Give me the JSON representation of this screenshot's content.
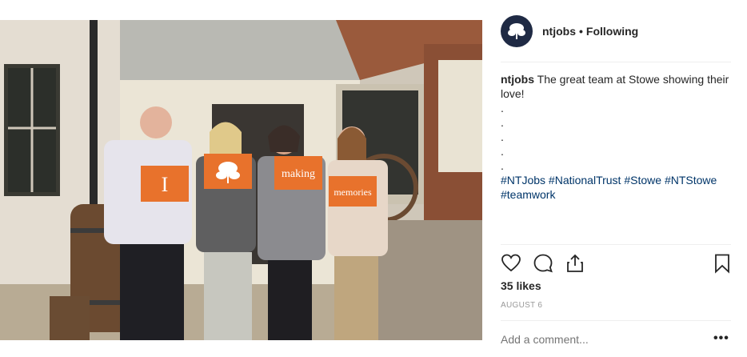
{
  "post": {
    "username": "ntjobs",
    "separator": "•",
    "follow_status": "Following",
    "caption_user": "ntjobs",
    "caption_text": "The great team at Stowe showing their love!",
    "caption_dots": [
      ".",
      ".",
      ".",
      ".",
      "."
    ],
    "hashtags": [
      "#NTJobs",
      "#NationalTrust",
      "#Stowe",
      "#NTStowe",
      "#teamwork"
    ],
    "likes": "35 likes",
    "date": "AUGUST 6",
    "comment_placeholder": "Add a comment...",
    "more_label": "•••"
  },
  "photo": {
    "signs": [
      "I",
      "making",
      "memories"
    ]
  },
  "colors": {
    "sign_orange": "#e8722c",
    "avatar_bg": "#1f2a44",
    "hashtag": "#003569"
  },
  "icons": {
    "like": "heart-icon",
    "comment": "comment-icon",
    "share": "share-icon",
    "save": "bookmark-icon",
    "avatar": "oak-leaf-icon"
  }
}
